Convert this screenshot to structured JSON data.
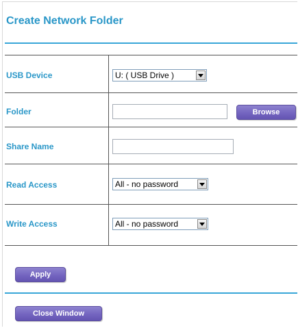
{
  "header": {
    "title": "Create Network Folder"
  },
  "form": {
    "usb_device": {
      "label": "USB Device",
      "value": "U: ( USB Drive )"
    },
    "folder": {
      "label": "Folder",
      "value": "",
      "browse_label": "Browse"
    },
    "share_name": {
      "label": "Share Name",
      "value": ""
    },
    "read_access": {
      "label": "Read Access",
      "value": "All - no password"
    },
    "write_access": {
      "label": "Write Access",
      "value": "All - no password"
    }
  },
  "actions": {
    "apply_label": "Apply",
    "close_label": "Close Window"
  },
  "colors": {
    "label": "#2a97c8",
    "rule": "#38a6d8",
    "button": "#7465c0"
  }
}
